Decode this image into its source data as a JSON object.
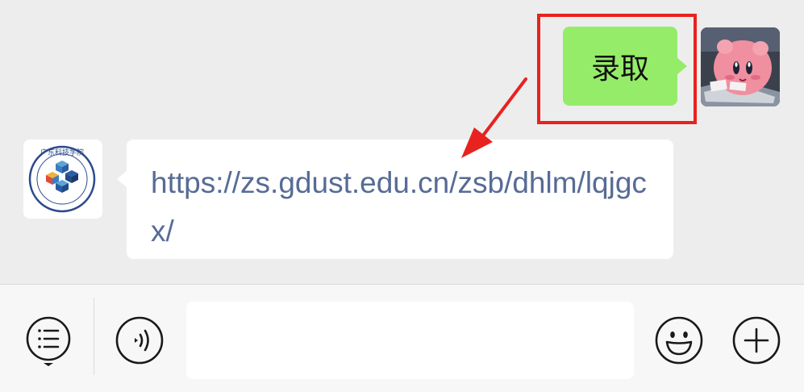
{
  "chat": {
    "sent_message": {
      "text": "录取",
      "highlighted": true,
      "highlight_color": "#e8221e",
      "bubble_color": "#95ec69"
    },
    "received_message": {
      "text": "https://zs.gdust.edu.cn/zsb/dhlm/lqjgcx/",
      "link_color": "#576b95"
    },
    "annotation_arrow": {
      "color": "#e8221e",
      "from": "sent-message",
      "to": "received-link"
    },
    "user_avatar": {
      "icon": "plush-toy-avatar"
    },
    "school_avatar": {
      "icon": "university-logo",
      "logo_lettering": "广东科技学院 GUANGDONG UNIVERSITY OF SCIENCE & TECHNOLOGY"
    }
  },
  "input_bar": {
    "menu_icon": "menu-list-icon",
    "voice_icon": "voice-icon",
    "input_value": "",
    "emoji_icon": "emoji-icon",
    "plus_icon": "plus-icon"
  }
}
